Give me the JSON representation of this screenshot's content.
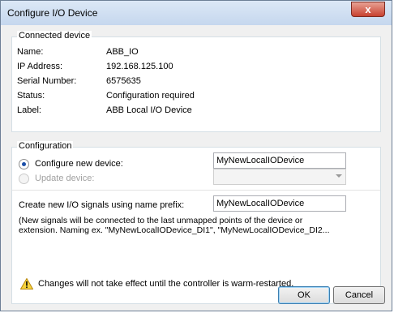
{
  "window": {
    "title": "Configure I/O Device",
    "close_label": "x"
  },
  "connected_device": {
    "legend": "Connected device",
    "rows": [
      {
        "label": "Name:",
        "value": "ABB_IO"
      },
      {
        "label": "IP Address:",
        "value": "192.168.125.100"
      },
      {
        "label": "Serial Number:",
        "value": "6575635"
      },
      {
        "label": "Status:",
        "value": "Configuration required"
      },
      {
        "label": "Label:",
        "value": "ABB Local I/O Device"
      }
    ]
  },
  "configuration": {
    "legend": "Configuration",
    "configure_new_label": "Configure new device:",
    "configure_new_value": "MyNewLocalIODevice",
    "update_label": "Update device:",
    "update_value": ""
  },
  "signals": {
    "prefix_label": "Create new I/O signals using name prefix:",
    "prefix_value": "MyNewLocalIODevice",
    "note_line1": "(New signals will be connected to the last unmapped points of the device or",
    "note_line2": "extension. Naming ex. \"MyNewLocalIODevice_DI1\", \"MyNewLocalIODevice_DI2..."
  },
  "warning": {
    "icon": "warning-icon",
    "text": "Changes will not take effect until the controller is warm-restarted."
  },
  "buttons": {
    "ok": "OK",
    "cancel": "Cancel"
  }
}
